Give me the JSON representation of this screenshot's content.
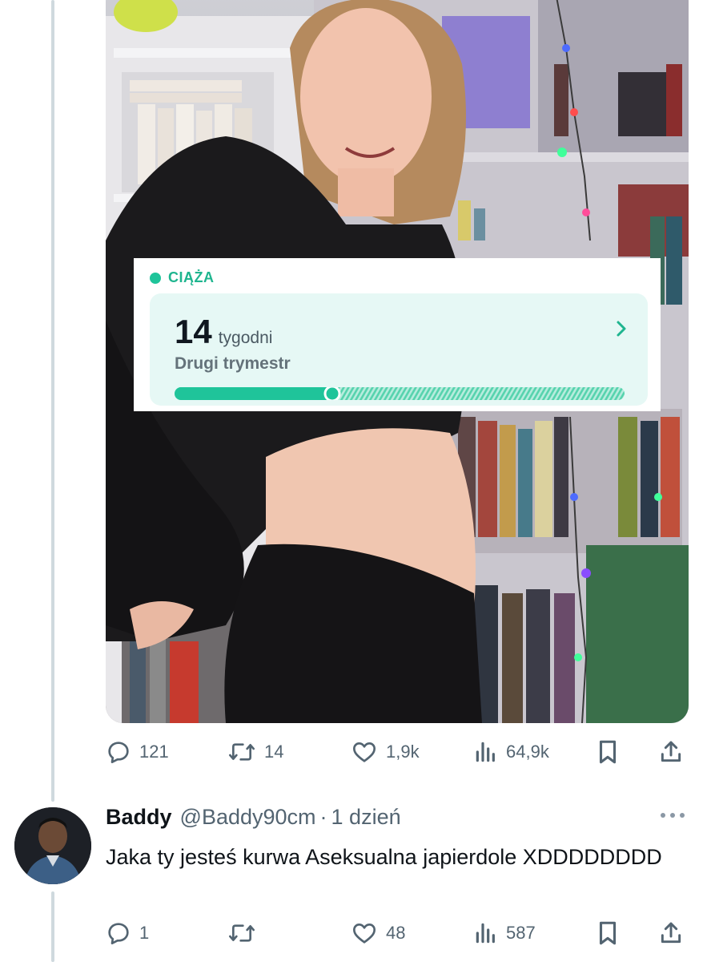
{
  "post": {
    "widget": {
      "label": "CIĄŻA",
      "weeks": "14",
      "weeks_unit": "tygodni",
      "trimester": "Drugi trymestr",
      "progress": 0.35,
      "chevron_icon": "chevron-right-icon",
      "accent": "#1fc49a"
    },
    "actions": {
      "replies": "121",
      "reposts": "14",
      "likes": "1,9k",
      "views": "64,9k"
    }
  },
  "reply": {
    "name": "Baddy",
    "handle": "@Baddy90cm",
    "separator": "·",
    "time": "1 dzień",
    "text": "Jaka ty jesteś kurwa Aseksualna japierdole XDDDDDDDD",
    "actions": {
      "replies": "1",
      "reposts": "",
      "likes": "48",
      "views": "587"
    }
  },
  "icons": {
    "reply": "speech-bubble-icon",
    "repost": "repost-arrows-icon",
    "like": "heart-icon",
    "views": "bar-chart-icon",
    "bookmark": "bookmark-icon",
    "share": "share-upload-icon",
    "more": "more-dots-icon"
  },
  "colors": {
    "text_secondary": "#536471",
    "thread_line": "#cfd9de",
    "accent_green": "#1fb58f"
  }
}
